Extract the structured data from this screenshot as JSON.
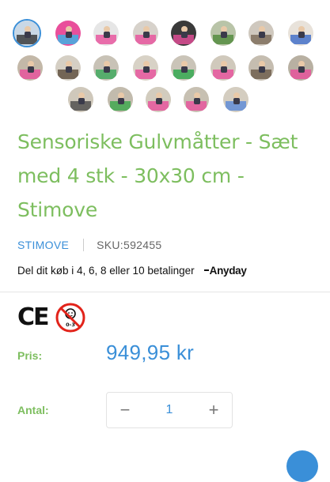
{
  "gallery": {
    "active_index": 0,
    "thumbnails": [
      {
        "name": "thumb-1",
        "bg": "#c9d8e6",
        "fg": "#333"
      },
      {
        "name": "thumb-2",
        "bg": "#e94f9b",
        "fg": "#35b6e8"
      },
      {
        "name": "thumb-3",
        "bg": "#e6e6e6",
        "fg": "#e94f9b"
      },
      {
        "name": "thumb-4",
        "bg": "#d7d2cb",
        "fg": "#e94f9b"
      },
      {
        "name": "thumb-5",
        "bg": "#3a3a3a",
        "fg": "#e94f9b"
      },
      {
        "name": "thumb-6",
        "bg": "#b9c4a8",
        "fg": "#4f8a3a"
      },
      {
        "name": "thumb-7",
        "bg": "#cfc8be",
        "fg": "#7a6a58"
      },
      {
        "name": "thumb-8",
        "bg": "#e8e2da",
        "fg": "#3a6ac8"
      },
      {
        "name": "thumb-9",
        "bg": "#c3b8a8",
        "fg": "#e94f9b"
      },
      {
        "name": "thumb-10",
        "bg": "#d5cfc4",
        "fg": "#5a4a3a"
      },
      {
        "name": "thumb-11",
        "bg": "#c8c2b6",
        "fg": "#3aa85a"
      },
      {
        "name": "thumb-12",
        "bg": "#d8d2c6",
        "fg": "#e94f9b"
      },
      {
        "name": "thumb-13",
        "bg": "#cac4b8",
        "fg": "#2aa84a"
      },
      {
        "name": "thumb-14",
        "bg": "#d0c9bc",
        "fg": "#e94f9b"
      },
      {
        "name": "thumb-15",
        "bg": "#c5bdb0",
        "fg": "#6a5a48"
      },
      {
        "name": "thumb-16",
        "bg": "#b8b0a2",
        "fg": "#e94f9b"
      },
      {
        "name": "thumb-17",
        "bg": "#cfc8bb",
        "fg": "#4a4a4a"
      },
      {
        "name": "thumb-18",
        "bg": "#c2bbad",
        "fg": "#3aa84a"
      },
      {
        "name": "thumb-19",
        "bg": "#d2ccbe",
        "fg": "#e94f9b"
      },
      {
        "name": "thumb-20",
        "bg": "#c7c0b2",
        "fg": "#e94f9b"
      },
      {
        "name": "thumb-21",
        "bg": "#d4cdc0",
        "fg": "#5a8ad8"
      }
    ]
  },
  "product": {
    "title": "Sensoriske Gulvmåtter - Sæt med 4 stk - 30x30 cm - Stimove",
    "brand": "STIMOVE",
    "sku": "SKU:592455",
    "installment_text": "Del dit køb i 4, 6, 8 eller 10 betalinger",
    "installment_provider": "Anyday",
    "ce_mark": "CE",
    "warning_age_label": "0-3",
    "price_label": "Pris:",
    "price": "949,95 kr",
    "quantity_label": "Antal:",
    "quantity": "1",
    "decrement_symbol": "−",
    "increment_symbol": "+"
  },
  "colors": {
    "accent_green": "#7dbe5f",
    "accent_blue": "#3a8fd8"
  }
}
